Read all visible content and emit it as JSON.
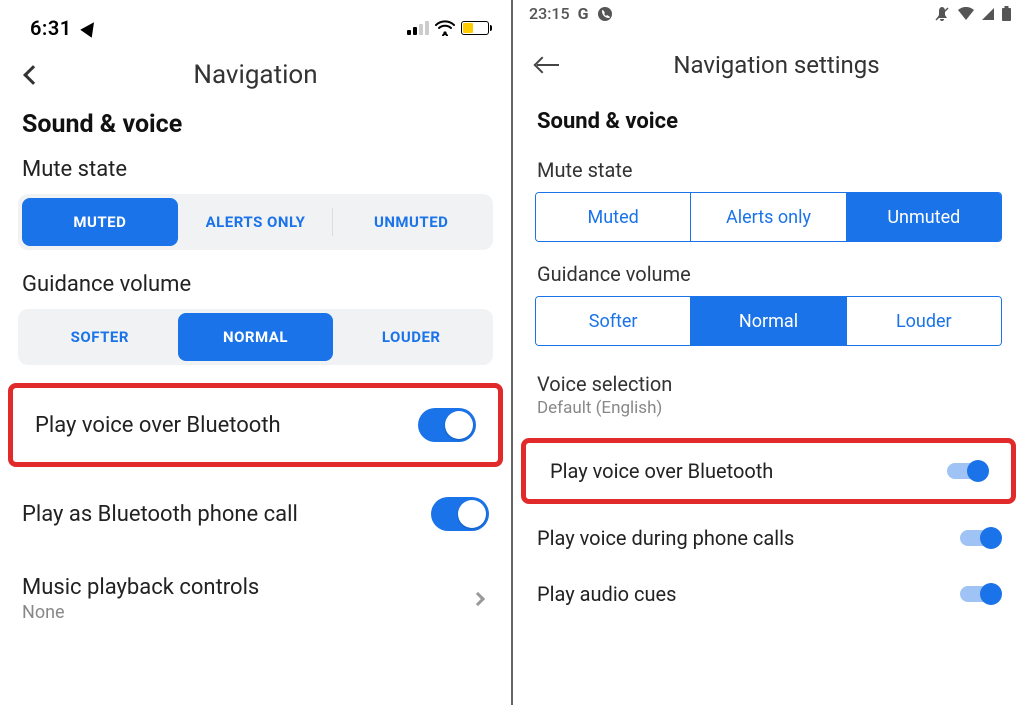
{
  "ios": {
    "status_time": "6:31",
    "header_title": "Navigation",
    "section_title": "Sound & voice",
    "mute_state_label": "Mute state",
    "mute_options": {
      "muted": "MUTED",
      "alerts": "ALERTS ONLY",
      "unmuted": "UNMUTED"
    },
    "guidance_label": "Guidance volume",
    "guidance_options": {
      "softer": "SOFTER",
      "normal": "NORMAL",
      "louder": "LOUDER"
    },
    "play_bt_label": "Play voice over Bluetooth",
    "play_as_call_label": "Play as Bluetooth phone call",
    "music_label": "Music playback controls",
    "music_value": "None"
  },
  "android": {
    "status_time": "23:15",
    "status_g": "G",
    "header_title": "Navigation settings",
    "section_title": "Sound & voice",
    "mute_state_label": "Mute state",
    "mute_options": {
      "muted": "Muted",
      "alerts": "Alerts only",
      "unmuted": "Unmuted"
    },
    "guidance_label": "Guidance volume",
    "guidance_options": {
      "softer": "Softer",
      "normal": "Normal",
      "louder": "Louder"
    },
    "voice_sel_title": "Voice selection",
    "voice_sel_value": "Default (English)",
    "play_bt_label": "Play voice over Bluetooth",
    "play_during_calls_label": "Play voice during phone calls",
    "play_audio_cues_label": "Play audio cues"
  }
}
